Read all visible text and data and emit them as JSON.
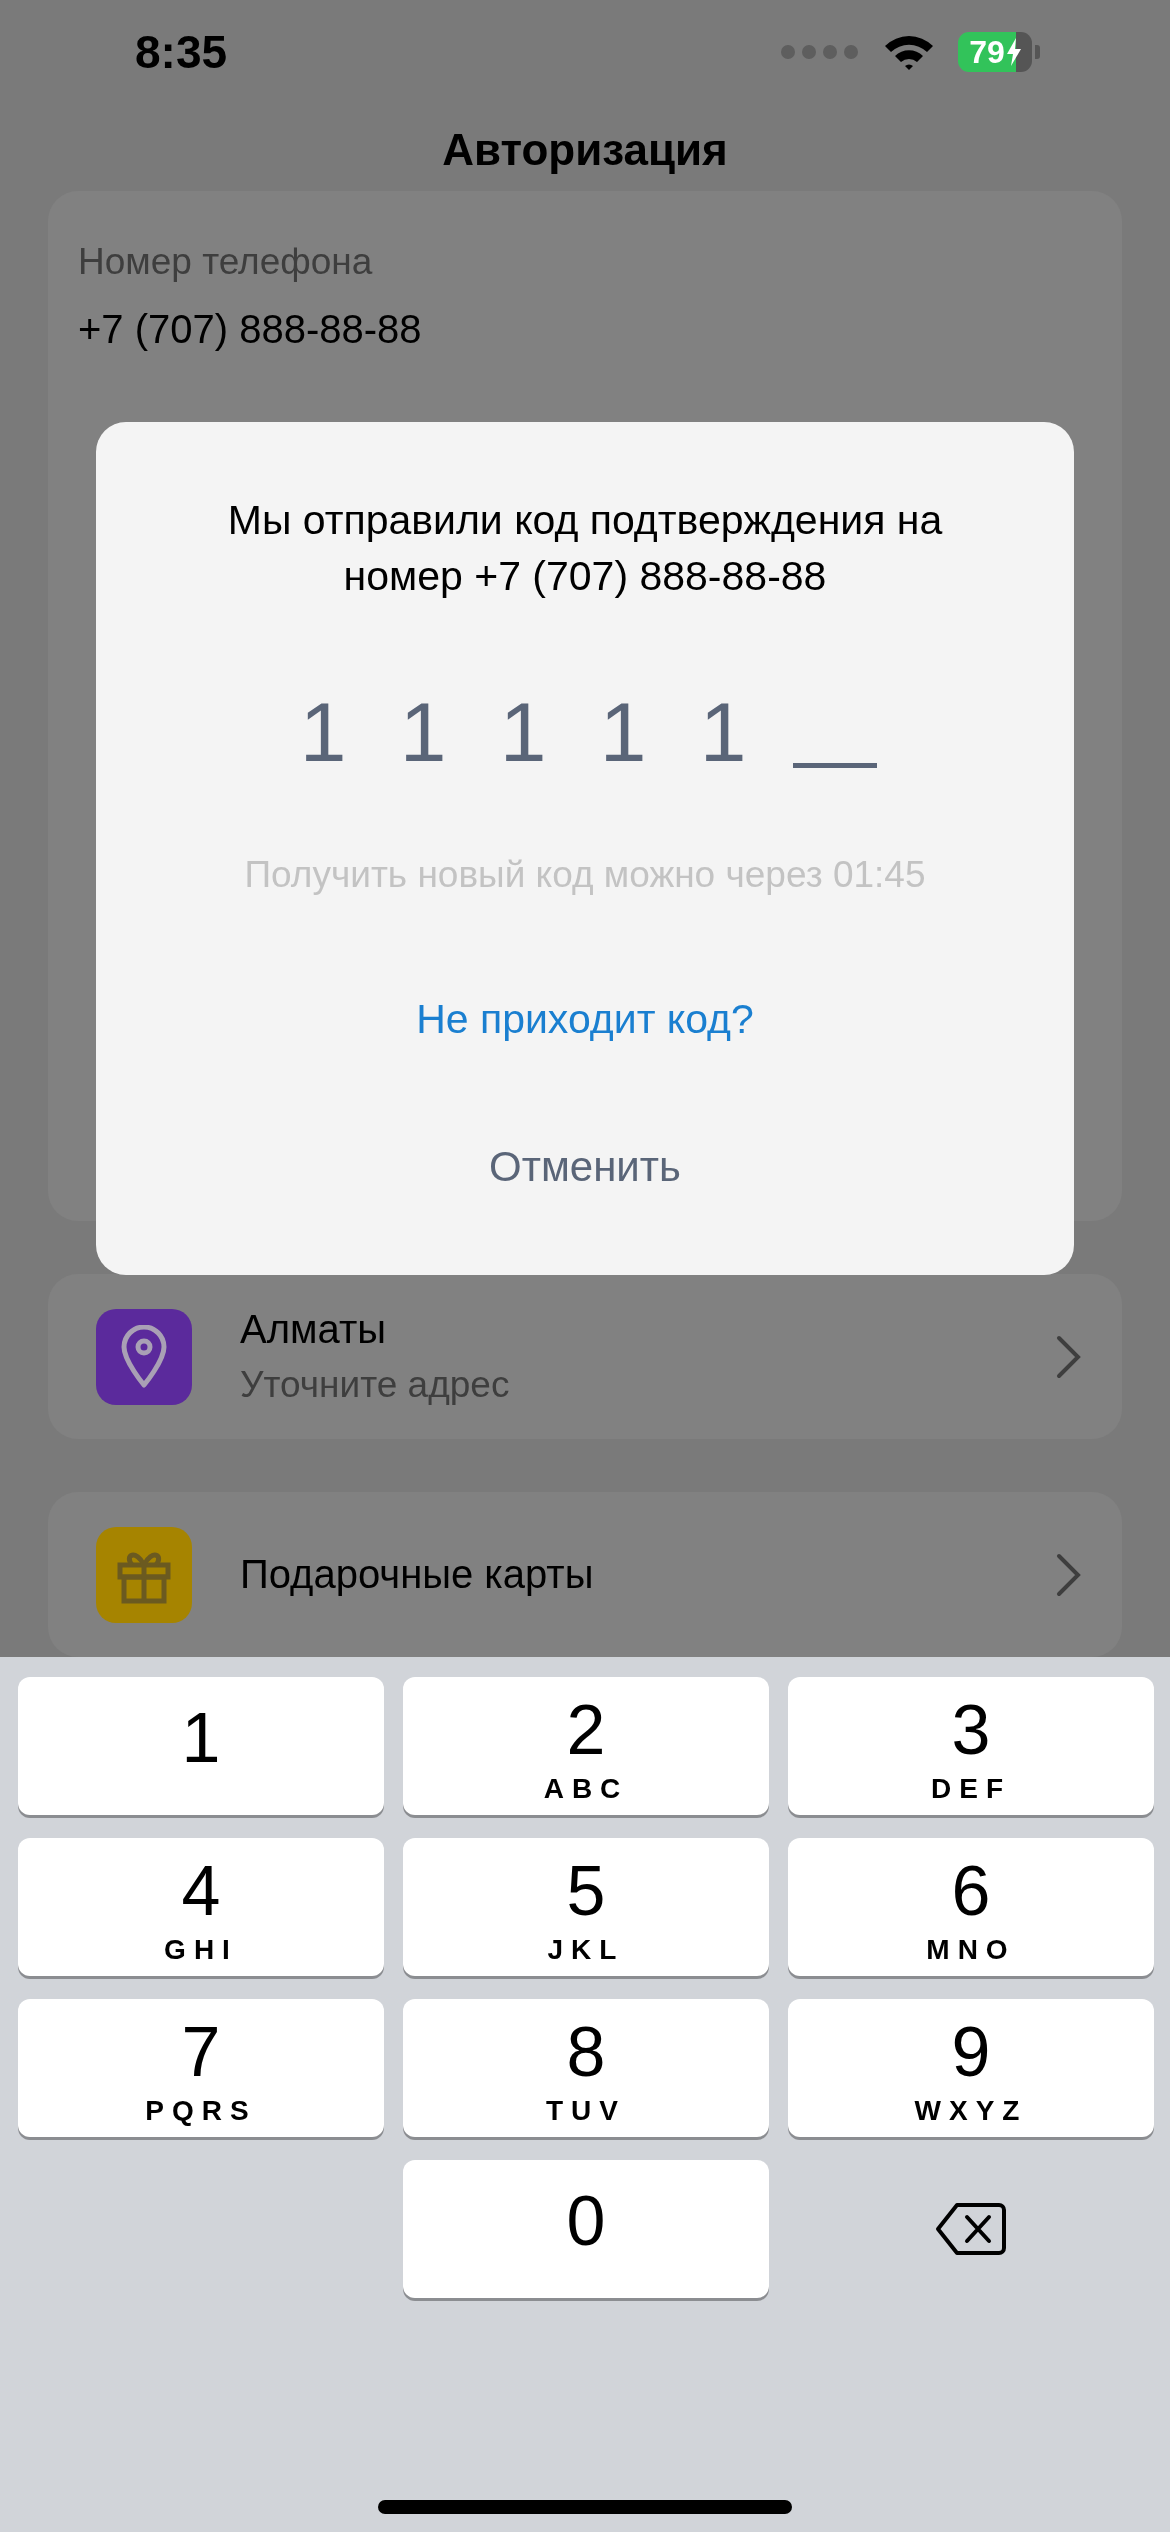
{
  "status_bar": {
    "time": "8:35",
    "battery": "79",
    "charging": true
  },
  "header": {
    "title": "Авторизация"
  },
  "phone_card": {
    "label": "Номер телефона",
    "value": "+7 (707) 888-88-88"
  },
  "menu_items": [
    {
      "title": "Алматы",
      "subtitle": "Уточните адрес",
      "kind": "pin",
      "color": "#5b2a9c"
    },
    {
      "title": "Подарочные карты",
      "kind": "gift",
      "color": "#a68400"
    }
  ],
  "dialog": {
    "message": "Мы отправили код подтверждения на номер +7 (707) 888-88-88",
    "code_slots": [
      {
        "value": "1",
        "filled": true
      },
      {
        "value": "1",
        "filled": true
      },
      {
        "value": "1",
        "filled": true
      },
      {
        "value": "1",
        "filled": true
      },
      {
        "value": "1",
        "filled": true
      },
      {
        "filled": false
      }
    ],
    "timer_text": "Получить новый код можно через 01:45",
    "help_link": "Не приходит код?",
    "cancel": "Отменить"
  },
  "keypad": [
    {
      "kind": "key",
      "digit": "1"
    },
    {
      "kind": "key",
      "digit": "2",
      "letters": "ABC"
    },
    {
      "kind": "key",
      "digit": "3",
      "letters": "DEF"
    },
    {
      "kind": "key",
      "digit": "4",
      "letters": "GHI"
    },
    {
      "kind": "key",
      "digit": "5",
      "letters": "JKL"
    },
    {
      "kind": "key",
      "digit": "6",
      "letters": "MNO"
    },
    {
      "kind": "key",
      "digit": "7",
      "letters": "PQRS"
    },
    {
      "kind": "key",
      "digit": "8",
      "letters": "TUV"
    },
    {
      "kind": "key",
      "digit": "9",
      "letters": "WXYZ"
    },
    {
      "kind": "blank"
    },
    {
      "kind": "key",
      "digit": "0"
    },
    {
      "kind": "backspace"
    }
  ]
}
